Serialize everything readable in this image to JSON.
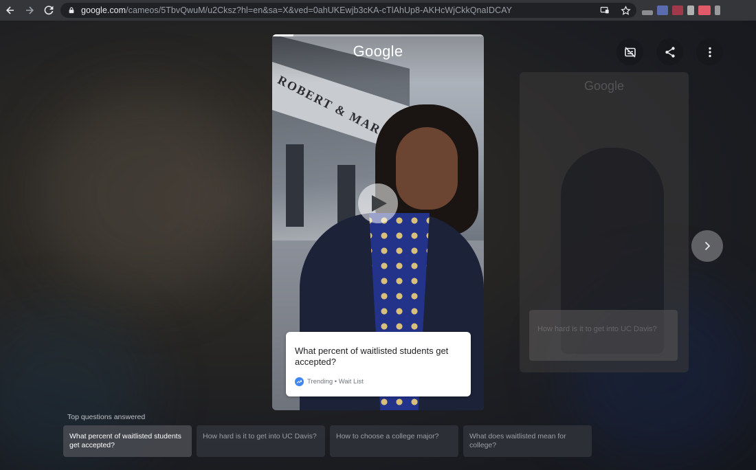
{
  "browser": {
    "url_host": "google.com",
    "url_path": "/cameos/5TbvQwuM/u2Cksz?hl=en&sa=X&ved=0ahUKEwjb3cKA-cTlAhUp8-AKHcWjCkkQnaIDCAY",
    "nav_icons": [
      "back-arrow-icon",
      "forward-arrow-icon",
      "reload-icon"
    ],
    "omnibox_icons": [
      "cast-icon",
      "bookmark-star-icon"
    ],
    "extension_colors": [
      "#8a8c90",
      "#5b6bb0",
      "#a03a4a",
      "#b0b0b0",
      "#e05a6a",
      "#9a9a9a"
    ]
  },
  "card": {
    "logo": "Google",
    "building_sign": "ROBERT & MARGR",
    "progress_fraction": 0.1,
    "question": "What percent of waitlisted students get accepted?",
    "meta": "Trending • Wait List",
    "play_icon": "play-icon"
  },
  "ghost_card": {
    "logo": "Google",
    "question": "How hard is it to get into UC Davis?"
  },
  "controls": {
    "icons": [
      "captions-off-icon",
      "share-icon",
      "more-vert-icon"
    ],
    "next_icon": "chevron-right-icon"
  },
  "questions": {
    "label": "Top questions answered",
    "items": [
      {
        "text": "What percent of waitlisted students get accepted?",
        "active": true
      },
      {
        "text": "How hard is it to get into UC Davis?",
        "active": false
      },
      {
        "text": "How to choose a college major?",
        "active": false
      },
      {
        "text": "What does waitlisted mean for college?",
        "active": false
      }
    ]
  },
  "colors": {
    "accent_blue": "#4285f4",
    "chrome_bg": "#35363a",
    "omnibox_bg": "#202124"
  }
}
